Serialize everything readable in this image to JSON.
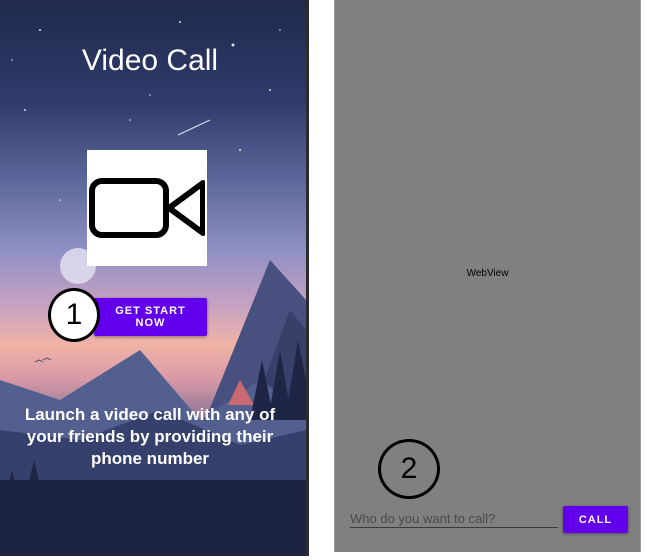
{
  "screen1": {
    "title": "Video Call",
    "icon": "video-camera-icon",
    "start_button": "GET START NOW",
    "tagline": "Launch a video call with any of your friends by providing their phone number"
  },
  "screen2": {
    "webview_label": "WebView",
    "input_placeholder": "Who do you want to call?",
    "call_button": "CALL"
  },
  "annotations": {
    "marker1": "1",
    "marker2": "2"
  },
  "colors": {
    "accent": "#6200ee",
    "webview_bg": "#808080"
  }
}
